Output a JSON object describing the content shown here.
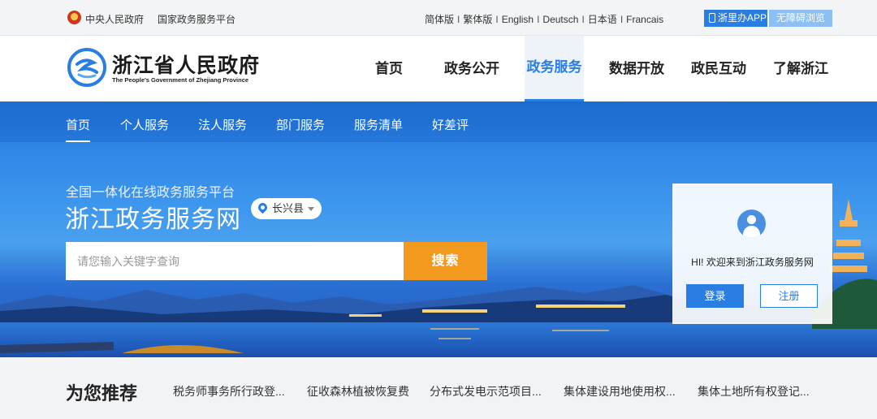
{
  "topbar": {
    "central_gov": "中央人民政府",
    "national_platform": "国家政务服务平台",
    "languages": [
      "简体版",
      "繁体版",
      "English",
      "Deutsch",
      "日本语",
      "Francais"
    ],
    "separator": "I",
    "app_button": "浙里办APP",
    "accessibility_button": "无障碍浏览"
  },
  "header": {
    "logo_cn": "浙江省人民政府",
    "logo_en": "The People's Government of Zhejiang Province",
    "nav": [
      "首页",
      "政务公开",
      "政务服务",
      "数据开放",
      "政民互动",
      "了解浙江"
    ],
    "active_nav": "政务服务"
  },
  "subnav": {
    "items": [
      "首页",
      "个人服务",
      "法人服务",
      "部门服务",
      "服务清单",
      "好差评"
    ],
    "active": "首页"
  },
  "hero": {
    "subtitle": "全国一体化在线政务服务平台",
    "title": "浙江政务服务网",
    "location": "长兴县",
    "search_placeholder": "请您输入关键字查询",
    "search_button": "搜索"
  },
  "login_card": {
    "welcome": "HI! 欢迎来到浙江政务服务网",
    "login": "登录",
    "register": "注册"
  },
  "recommend": {
    "title": "为您推荐",
    "items": [
      "税务师事务所行政登...",
      "征收森林植被恢复费",
      "分布式发电示范项目...",
      "集体建设用地使用权...",
      "集体土地所有权登记..."
    ]
  },
  "colors": {
    "brand_blue": "#2a7de1",
    "search_orange": "#f39a1e"
  }
}
